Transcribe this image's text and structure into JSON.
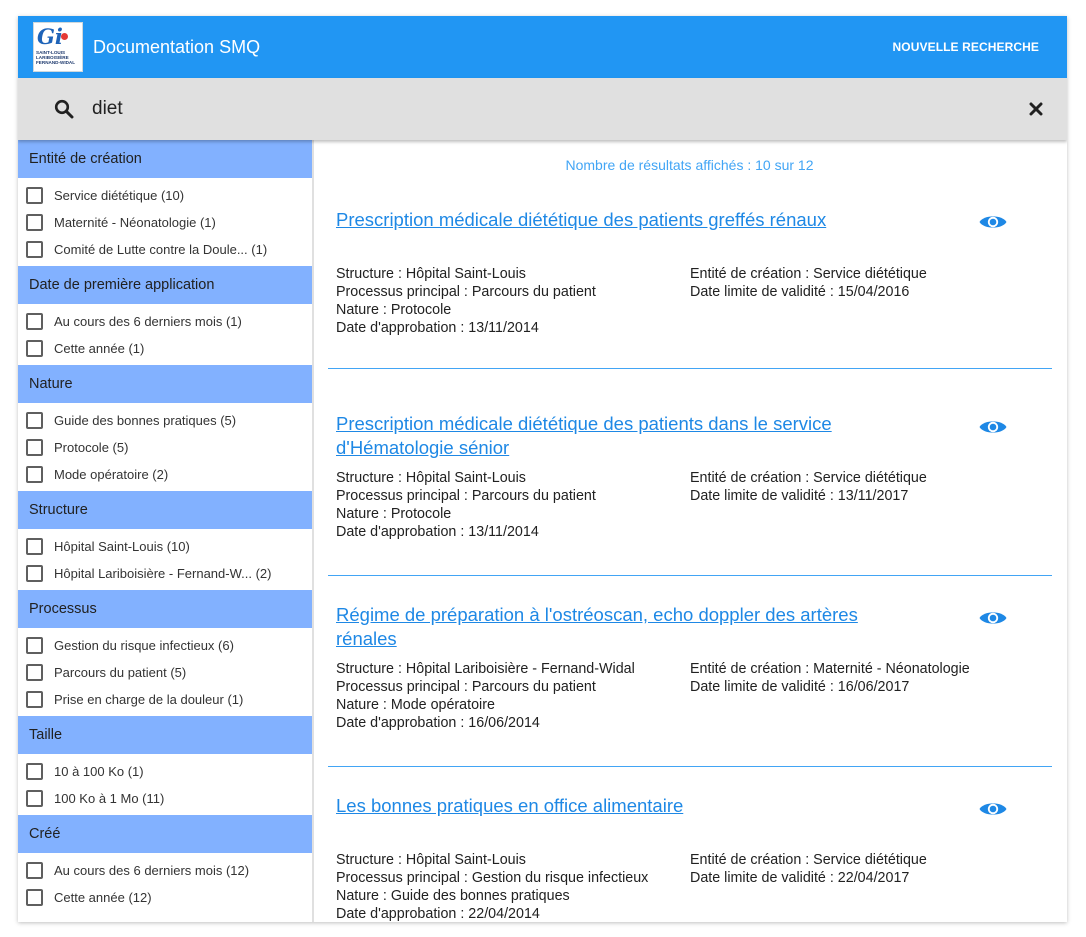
{
  "header": {
    "logo_mark": "Gi",
    "logo_text": "SAINT-LOUIS LARIBOISIÈRE FERNAND-WIDAL",
    "title": "Documentation SMQ",
    "new_search": "NOUVELLE RECHERCHE",
    "accent_color": "#2196f3"
  },
  "search": {
    "value": "diet",
    "icon": "search-icon",
    "clear_icon": "close-icon"
  },
  "facets": [
    {
      "title": "Entité de création",
      "items": [
        {
          "label": "Service diététique (10)"
        },
        {
          "label": "Maternité - Néonatologie (1)"
        },
        {
          "label": "Comité de Lutte contre la Doule... (1)"
        }
      ]
    },
    {
      "title": "Date de première application",
      "items": [
        {
          "label": "Au cours des 6 derniers mois (1)"
        },
        {
          "label": "Cette année (1)"
        }
      ]
    },
    {
      "title": "Nature",
      "items": [
        {
          "label": "Guide des bonnes pratiques (5)"
        },
        {
          "label": "Protocole (5)"
        },
        {
          "label": "Mode opératoire (2)"
        }
      ]
    },
    {
      "title": "Structure",
      "items": [
        {
          "label": "Hôpital Saint-Louis (10)"
        },
        {
          "label": "Hôpital Lariboisière - Fernand-W... (2)"
        }
      ]
    },
    {
      "title": "Processus",
      "items": [
        {
          "label": "Gestion du risque infectieux (6)"
        },
        {
          "label": "Parcours du patient (5)"
        },
        {
          "label": "Prise en charge de la douleur (1)"
        }
      ]
    },
    {
      "title": "Taille",
      "items": [
        {
          "label": "10 à 100 Ko (1)"
        },
        {
          "label": "100 Ko à 1 Mo (11)"
        }
      ]
    },
    {
      "title": "Créé",
      "items": [
        {
          "label": "Au cours des 6 derniers mois (12)"
        },
        {
          "label": "Cette année (12)"
        }
      ]
    }
  ],
  "results_count": "Nombre de résultats affichés : 10 sur 12",
  "results": [
    {
      "title": "Prescription médicale diététique des patients greffés rénaux",
      "structure": "Structure : Hôpital Saint-Louis",
      "processus": "Processus principal : Parcours du patient",
      "nature": "Nature : Protocole",
      "approbation": "Date d'approbation : 13/11/2014",
      "entite": "Entité de création : Service diététique",
      "validite": "Date limite de validité : 15/04/2016"
    },
    {
      "title": "Prescription médicale diététique des patients dans le service d'Hématologie sénior",
      "structure": "Structure : Hôpital Saint-Louis",
      "processus": "Processus principal : Parcours du patient",
      "nature": "Nature : Protocole",
      "approbation": "Date d'approbation : 13/11/2014",
      "entite": "Entité de création : Service diététique",
      "validite": "Date limite de validité : 13/11/2017"
    },
    {
      "title": "Régime de préparation à l'ostréoscan, echo doppler des artères rénales",
      "structure": "Structure : Hôpital Lariboisière - Fernand-Widal",
      "processus": "Processus principal : Parcours du patient",
      "nature": "Nature : Mode opératoire",
      "approbation": "Date d'approbation : 16/06/2014",
      "entite": "Entité de création : Maternité - Néonatologie",
      "validite": "Date limite de validité : 16/06/2017"
    },
    {
      "title": "Les bonnes pratiques en office alimentaire",
      "structure": "Structure : Hôpital Saint-Louis",
      "processus": "Processus principal : Gestion du risque infectieux",
      "nature": "Nature : Guide des bonnes pratiques",
      "approbation": "Date d'approbation : 22/04/2014",
      "entite": "Entité de création : Service diététique",
      "validite": "Date limite de validité : 22/04/2017"
    }
  ],
  "icons": {
    "view": "eye-icon"
  }
}
